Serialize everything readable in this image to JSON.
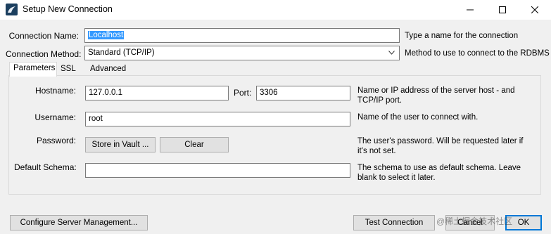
{
  "window": {
    "title": "Setup New Connection"
  },
  "form": {
    "connection_name": {
      "label": "Connection Name:",
      "value": "Localhost",
      "description": "Type a name for the connection"
    },
    "connection_method": {
      "label": "Connection Method:",
      "value": "Standard (TCP/IP)",
      "description": "Method to use to connect to the RDBMS"
    }
  },
  "tabs": [
    {
      "label": "Parameters",
      "active": true
    },
    {
      "label": "SSL",
      "active": false
    },
    {
      "label": "Advanced",
      "active": false
    }
  ],
  "parameters": {
    "hostname": {
      "label": "Hostname:",
      "value": "127.0.0.1",
      "description": "Name or IP address of the server host - and TCP/IP port."
    },
    "port": {
      "label": "Port:",
      "value": "3306"
    },
    "username": {
      "label": "Username:",
      "value": "root",
      "description": "Name of the user to connect with."
    },
    "password": {
      "label": "Password:",
      "store_button": "Store in Vault ...",
      "clear_button": "Clear",
      "description": "The user's password. Will be requested later if it's not set."
    },
    "default_schema": {
      "label": "Default Schema:",
      "value": "",
      "description": "The schema to use as default schema. Leave blank to select it later."
    }
  },
  "footer": {
    "configure_button": "Configure Server Management...",
    "test_button": "Test Connection",
    "cancel_button": "Cancel",
    "ok_button": "OK"
  },
  "watermark": "@稀土掘金技术社区",
  "colors": {
    "selection": "#3399ff",
    "default_button_border": "#0078d7"
  }
}
